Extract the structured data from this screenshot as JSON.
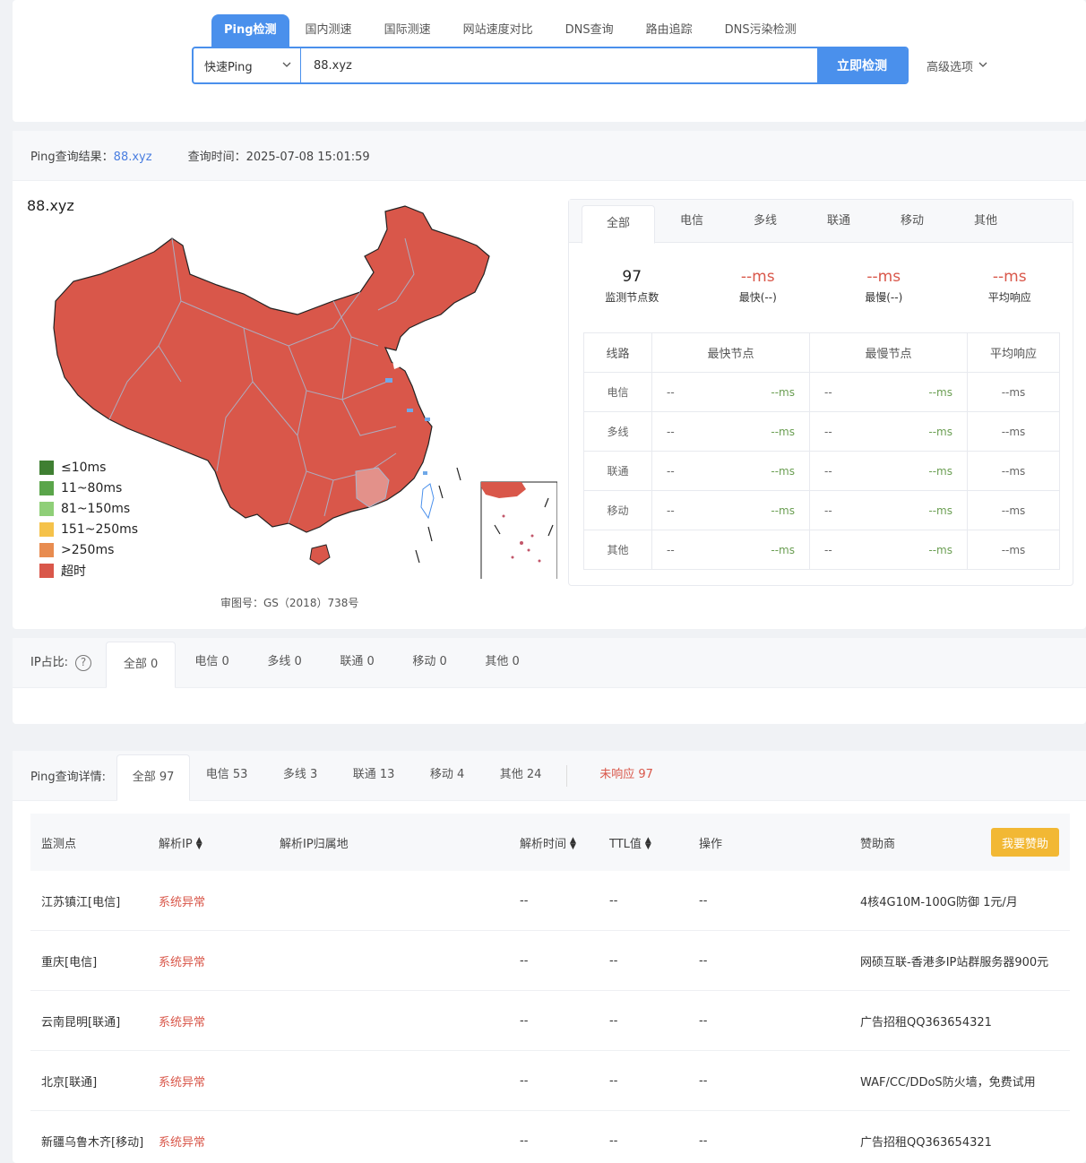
{
  "tool_tabs": [
    "Ping检测",
    "国内测速",
    "国际测速",
    "网站速度对比",
    "DNS查询",
    "路由追踪",
    "DNS污染检测"
  ],
  "search": {
    "mode": "快速Ping",
    "value": "88.xyz",
    "submit": "立即检测",
    "advanced": "高级选项"
  },
  "result": {
    "label": "Ping查询结果：",
    "domain": "88.xyz",
    "time_label": "查询时间：",
    "time": "2025-07-08 15:01:59",
    "map_title": "88.xyz",
    "map_note": "审图号：GS（2018）738号",
    "legend": [
      {
        "label": "≤10ms",
        "color": "#3f7f32"
      },
      {
        "label": "11~80ms",
        "color": "#5aa54a"
      },
      {
        "label": "81~150ms",
        "color": "#8fcf78"
      },
      {
        "label": "151~250ms",
        "color": "#f5c24a"
      },
      {
        "label": ">250ms",
        "color": "#e88c50"
      },
      {
        "label": "超时",
        "color": "#d9574a"
      }
    ]
  },
  "stats": {
    "tabs": [
      "全部",
      "电信",
      "多线",
      "联通",
      "移动",
      "其他"
    ],
    "items": [
      {
        "num": "97",
        "label": "监测节点数"
      },
      {
        "num": "--ms",
        "label": "最快(--)"
      },
      {
        "num": "--ms",
        "label": "最慢(--)"
      },
      {
        "num": "--ms",
        "label": "平均响应"
      }
    ],
    "table_headers": [
      "线路",
      "最快节点",
      "最慢节点",
      "平均响应"
    ],
    "rows": [
      {
        "line": "电信",
        "fast": "--",
        "fast_ms": "--ms",
        "slow": "--",
        "slow_ms": "--ms",
        "avg": "--ms"
      },
      {
        "line": "多线",
        "fast": "--",
        "fast_ms": "--ms",
        "slow": "--",
        "slow_ms": "--ms",
        "avg": "--ms"
      },
      {
        "line": "联通",
        "fast": "--",
        "fast_ms": "--ms",
        "slow": "--",
        "slow_ms": "--ms",
        "avg": "--ms"
      },
      {
        "line": "移动",
        "fast": "--",
        "fast_ms": "--ms",
        "slow": "--",
        "slow_ms": "--ms",
        "avg": "--ms"
      },
      {
        "line": "其他",
        "fast": "--",
        "fast_ms": "--ms",
        "slow": "--",
        "slow_ms": "--ms",
        "avg": "--ms"
      }
    ]
  },
  "ip_ratio": {
    "label": "IP占比:",
    "tabs": [
      "全部 0",
      "电信 0",
      "多线 0",
      "联通 0",
      "移动 0",
      "其他 0"
    ]
  },
  "details": {
    "label": "Ping查询详情:",
    "tabs": [
      "全部 97",
      "电信 53",
      "多线 3",
      "联通 13",
      "移动 4",
      "其他 24"
    ],
    "noresp": "未响应 97",
    "headers": [
      "监测点",
      "解析IP",
      "解析IP归属地",
      "解析时间",
      "TTL值",
      "操作",
      "赞助商"
    ],
    "sponsor_button": "我要赞助",
    "rows": [
      {
        "node": "江苏镇江[电信]",
        "ip": "系统异常",
        "loc": "",
        "time": "--",
        "ttl": "--",
        "op": "--",
        "sponsor": "4核4G10M-100G防御 1元/月"
      },
      {
        "node": "重庆[电信]",
        "ip": "系统异常",
        "loc": "",
        "time": "--",
        "ttl": "--",
        "op": "--",
        "sponsor": "网硕互联-香港多IP站群服务器900元"
      },
      {
        "node": "云南昆明[联通]",
        "ip": "系统异常",
        "loc": "",
        "time": "--",
        "ttl": "--",
        "op": "--",
        "sponsor": "广告招租QQ363654321"
      },
      {
        "node": "北京[联通]",
        "ip": "系统异常",
        "loc": "",
        "time": "--",
        "ttl": "--",
        "op": "--",
        "sponsor": "WAF/CC/DDoS防火墙，免费试用"
      },
      {
        "node": "新疆乌鲁木齐[移动]",
        "ip": "系统异常",
        "loc": "",
        "time": "--",
        "ttl": "--",
        "op": "--",
        "sponsor": "广告招租QQ363654321"
      }
    ]
  }
}
